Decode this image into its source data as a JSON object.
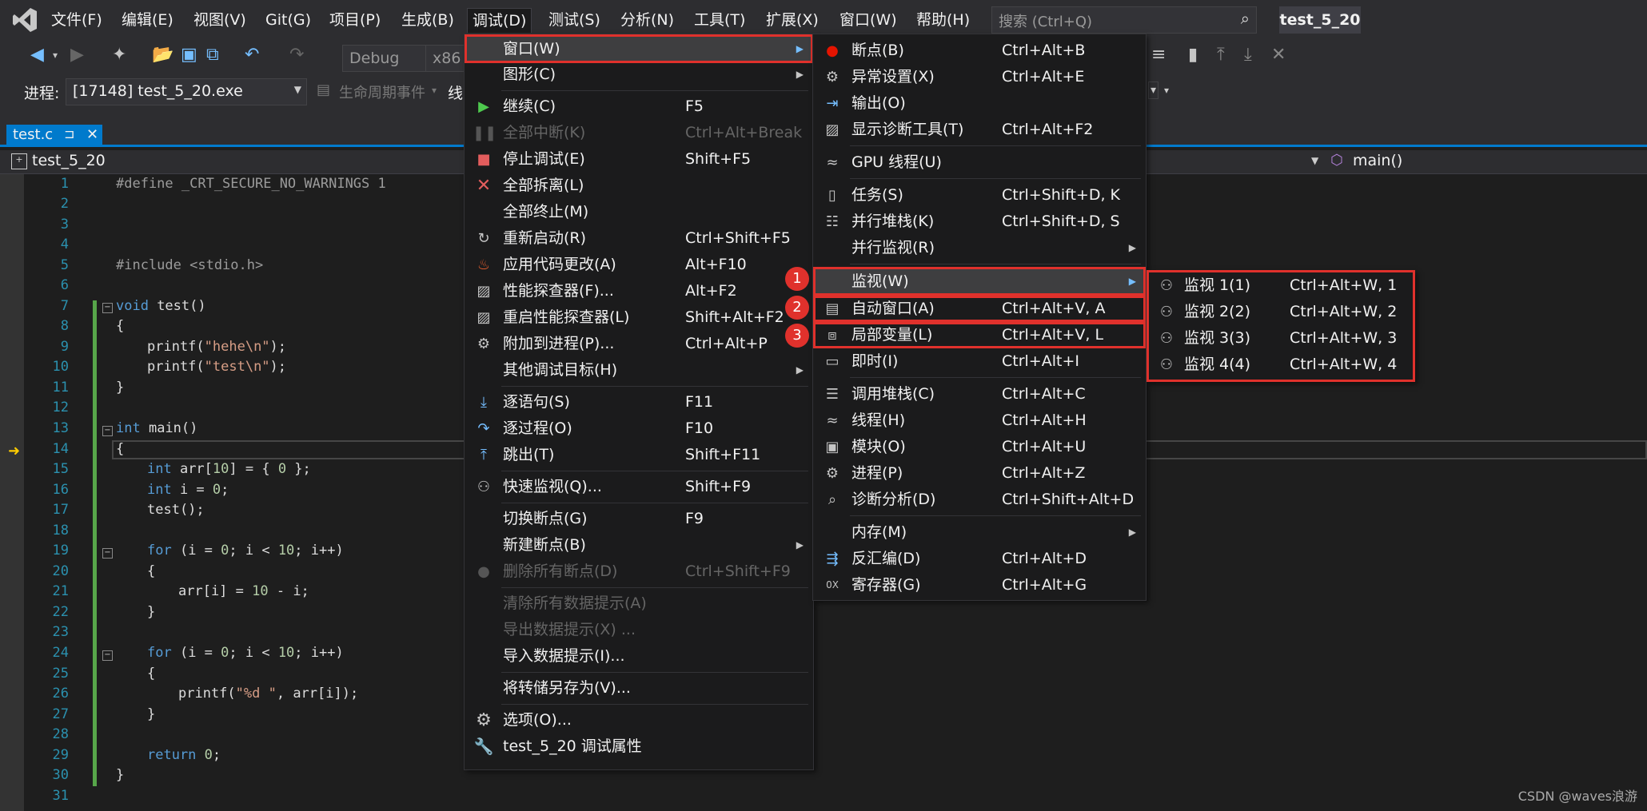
{
  "menubar": {
    "items": [
      "文件(F)",
      "编辑(E)",
      "视图(V)",
      "Git(G)",
      "项目(P)",
      "生成(B)",
      "调试(D)",
      "测试(S)",
      "分析(N)",
      "工具(T)",
      "扩展(X)",
      "窗口(W)",
      "帮助(H)"
    ],
    "search_placeholder": "搜索 (Ctrl+Q)",
    "solution_name": "test_5_20"
  },
  "toolbar": {
    "config": "Debug",
    "platform": "x86"
  },
  "procbar": {
    "label": "进程:",
    "process": "[17148] test_5_20.exe",
    "lifecycle": "生命周期事件",
    "thread_label": "线"
  },
  "tab": {
    "name": "test.c",
    "pin": "⊐",
    "close": "✕"
  },
  "navbar": {
    "project": "test_5_20",
    "scope": "main()"
  },
  "editor": {
    "line_numbers": [
      "1",
      "2",
      "3",
      "4",
      "5",
      "6",
      "7",
      "8",
      "9",
      "10",
      "11",
      "12",
      "13",
      "14",
      "15",
      "16",
      "17",
      "18",
      "19",
      "20",
      "21",
      "22",
      "23",
      "24",
      "25",
      "26",
      "27",
      "28",
      "29",
      "30",
      "31"
    ],
    "lines": {
      "l1": "#define _CRT_SECURE_NO_WARNINGS 1",
      "l5": "#include <stdio.h>",
      "l7a": "void",
      "l7b": " test()",
      "l8": "{",
      "l9a": "printf(",
      "l9b": "\"hehe\\n\"",
      "l9c": ");",
      "l10a": "printf(",
      "l10b": "\"test\\n\"",
      "l10c": ");",
      "l11": "}",
      "l13a": "int",
      "l13b": " main()",
      "l14": "{",
      "l15a": "int",
      "l15b": " arr[",
      "l15c": "10",
      "l15d": "] = { ",
      "l15e": "0",
      "l15f": " };",
      "l16a": "int",
      "l16b": " i = ",
      "l16c": "0",
      "l16d": ";",
      "l17": "test();",
      "l19a": "for",
      "l19b": " (i = ",
      "l19c": "0",
      "l19d": "; i < ",
      "l19e": "10",
      "l19f": "; i++)",
      "l20": "{",
      "l21a": "arr[i] = ",
      "l21b": "10",
      "l21c": " - i;",
      "l22": "}",
      "l24a": "for",
      "l24b": " (i = ",
      "l24c": "0",
      "l24d": "; i < ",
      "l24e": "10",
      "l24f": "; i++)",
      "l25": "{",
      "l26a": "printf(",
      "l26b": "\"%d \"",
      "l26c": ", arr[i]);",
      "l27": "}",
      "l29a": "return",
      "l29b": " ",
      "l29c": "0",
      "l29d": ";",
      "l30": "}"
    }
  },
  "debug_menu": {
    "items": [
      {
        "label": "窗口(W)",
        "shortcut": ""
      },
      {
        "label": "图形(C)",
        "shortcut": ""
      },
      {
        "label": "继续(C)",
        "shortcut": "F5"
      },
      {
        "label": "全部中断(K)",
        "shortcut": "Ctrl+Alt+Break"
      },
      {
        "label": "停止调试(E)",
        "shortcut": "Shift+F5"
      },
      {
        "label": "全部拆离(L)",
        "shortcut": ""
      },
      {
        "label": "全部终止(M)",
        "shortcut": ""
      },
      {
        "label": "重新启动(R)",
        "shortcut": "Ctrl+Shift+F5"
      },
      {
        "label": "应用代码更改(A)",
        "shortcut": "Alt+F10"
      },
      {
        "label": "性能探查器(F)...",
        "shortcut": "Alt+F2"
      },
      {
        "label": "重启性能探查器(L)",
        "shortcut": "Shift+Alt+F2"
      },
      {
        "label": "附加到进程(P)...",
        "shortcut": "Ctrl+Alt+P"
      },
      {
        "label": "其他调试目标(H)",
        "shortcut": ""
      },
      {
        "label": "逐语句(S)",
        "shortcut": "F11"
      },
      {
        "label": "逐过程(O)",
        "shortcut": "F10"
      },
      {
        "label": "跳出(T)",
        "shortcut": "Shift+F11"
      },
      {
        "label": "快速监视(Q)...",
        "shortcut": "Shift+F9"
      },
      {
        "label": "切换断点(G)",
        "shortcut": "F9"
      },
      {
        "label": "新建断点(B)",
        "shortcut": ""
      },
      {
        "label": "删除所有断点(D)",
        "shortcut": "Ctrl+Shift+F9"
      },
      {
        "label": "清除所有数据提示(A)",
        "shortcut": ""
      },
      {
        "label": "导出数据提示(X) ...",
        "shortcut": ""
      },
      {
        "label": "导入数据提示(I)...",
        "shortcut": ""
      },
      {
        "label": "将转储另存为(V)...",
        "shortcut": ""
      },
      {
        "label": "选项(O)...",
        "shortcut": ""
      },
      {
        "label": "test_5_20 调试属性",
        "shortcut": ""
      }
    ]
  },
  "window_menu": {
    "items": [
      {
        "label": "断点(B)",
        "shortcut": "Ctrl+Alt+B"
      },
      {
        "label": "异常设置(X)",
        "shortcut": "Ctrl+Alt+E"
      },
      {
        "label": "输出(O)",
        "shortcut": ""
      },
      {
        "label": "显示诊断工具(T)",
        "shortcut": "Ctrl+Alt+F2"
      },
      {
        "label": "GPU 线程(U)",
        "shortcut": ""
      },
      {
        "label": "任务(S)",
        "shortcut": "Ctrl+Shift+D, K"
      },
      {
        "label": "并行堆栈(K)",
        "shortcut": "Ctrl+Shift+D, S"
      },
      {
        "label": "并行监视(R)",
        "shortcut": ""
      },
      {
        "label": "监视(W)",
        "shortcut": ""
      },
      {
        "label": "自动窗口(A)",
        "shortcut": "Ctrl+Alt+V, A"
      },
      {
        "label": "局部变量(L)",
        "shortcut": "Ctrl+Alt+V, L"
      },
      {
        "label": "即时(I)",
        "shortcut": "Ctrl+Alt+I"
      },
      {
        "label": "调用堆栈(C)",
        "shortcut": "Ctrl+Alt+C"
      },
      {
        "label": "线程(H)",
        "shortcut": "Ctrl+Alt+H"
      },
      {
        "label": "模块(O)",
        "shortcut": "Ctrl+Alt+U"
      },
      {
        "label": "进程(P)",
        "shortcut": "Ctrl+Alt+Z"
      },
      {
        "label": "诊断分析(D)",
        "shortcut": "Ctrl+Shift+Alt+D"
      },
      {
        "label": "内存(M)",
        "shortcut": ""
      },
      {
        "label": "反汇编(D)",
        "shortcut": "Ctrl+Alt+D"
      },
      {
        "label": "寄存器(G)",
        "shortcut": "Ctrl+Alt+G"
      }
    ]
  },
  "watch_menu": {
    "items": [
      {
        "label": "监视 1(1)",
        "shortcut": "Ctrl+Alt+W, 1"
      },
      {
        "label": "监视 2(2)",
        "shortcut": "Ctrl+Alt+W, 2"
      },
      {
        "label": "监视 3(3)",
        "shortcut": "Ctrl+Alt+W, 3"
      },
      {
        "label": "监视 4(4)",
        "shortcut": "Ctrl+Alt+W, 4"
      }
    ]
  },
  "badges": [
    "1",
    "2",
    "3"
  ],
  "watermark": "CSDN @waves浪游",
  "colors": {
    "accent": "#007acc",
    "highlight_red": "#e0312c",
    "menu_bg": "#1b1b1c"
  }
}
